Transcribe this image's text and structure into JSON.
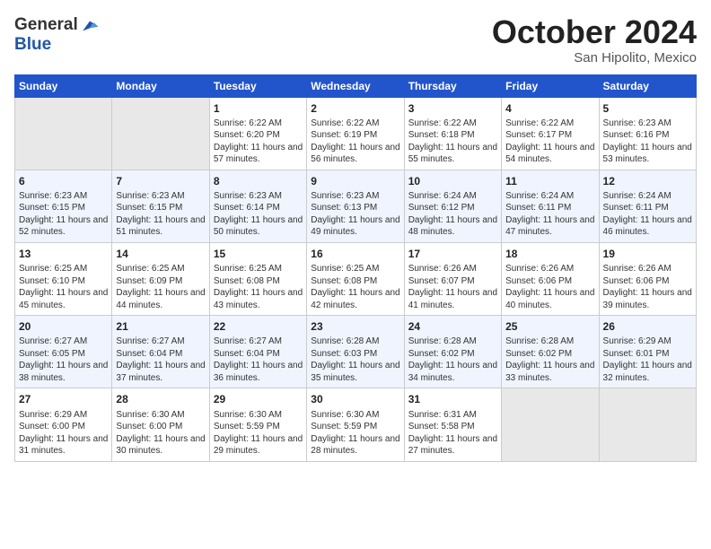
{
  "header": {
    "logo_line1": "General",
    "logo_line2": "Blue",
    "month": "October 2024",
    "location": "San Hipolito, Mexico"
  },
  "days_of_week": [
    "Sunday",
    "Monday",
    "Tuesday",
    "Wednesday",
    "Thursday",
    "Friday",
    "Saturday"
  ],
  "weeks": [
    [
      {
        "day": "",
        "sunrise": "",
        "sunset": "",
        "daylight": ""
      },
      {
        "day": "",
        "sunrise": "",
        "sunset": "",
        "daylight": ""
      },
      {
        "day": "1",
        "sunrise": "Sunrise: 6:22 AM",
        "sunset": "Sunset: 6:20 PM",
        "daylight": "Daylight: 11 hours and 57 minutes."
      },
      {
        "day": "2",
        "sunrise": "Sunrise: 6:22 AM",
        "sunset": "Sunset: 6:19 PM",
        "daylight": "Daylight: 11 hours and 56 minutes."
      },
      {
        "day": "3",
        "sunrise": "Sunrise: 6:22 AM",
        "sunset": "Sunset: 6:18 PM",
        "daylight": "Daylight: 11 hours and 55 minutes."
      },
      {
        "day": "4",
        "sunrise": "Sunrise: 6:22 AM",
        "sunset": "Sunset: 6:17 PM",
        "daylight": "Daylight: 11 hours and 54 minutes."
      },
      {
        "day": "5",
        "sunrise": "Sunrise: 6:23 AM",
        "sunset": "Sunset: 6:16 PM",
        "daylight": "Daylight: 11 hours and 53 minutes."
      }
    ],
    [
      {
        "day": "6",
        "sunrise": "Sunrise: 6:23 AM",
        "sunset": "Sunset: 6:15 PM",
        "daylight": "Daylight: 11 hours and 52 minutes."
      },
      {
        "day": "7",
        "sunrise": "Sunrise: 6:23 AM",
        "sunset": "Sunset: 6:15 PM",
        "daylight": "Daylight: 11 hours and 51 minutes."
      },
      {
        "day": "8",
        "sunrise": "Sunrise: 6:23 AM",
        "sunset": "Sunset: 6:14 PM",
        "daylight": "Daylight: 11 hours and 50 minutes."
      },
      {
        "day": "9",
        "sunrise": "Sunrise: 6:23 AM",
        "sunset": "Sunset: 6:13 PM",
        "daylight": "Daylight: 11 hours and 49 minutes."
      },
      {
        "day": "10",
        "sunrise": "Sunrise: 6:24 AM",
        "sunset": "Sunset: 6:12 PM",
        "daylight": "Daylight: 11 hours and 48 minutes."
      },
      {
        "day": "11",
        "sunrise": "Sunrise: 6:24 AM",
        "sunset": "Sunset: 6:11 PM",
        "daylight": "Daylight: 11 hours and 47 minutes."
      },
      {
        "day": "12",
        "sunrise": "Sunrise: 6:24 AM",
        "sunset": "Sunset: 6:11 PM",
        "daylight": "Daylight: 11 hours and 46 minutes."
      }
    ],
    [
      {
        "day": "13",
        "sunrise": "Sunrise: 6:25 AM",
        "sunset": "Sunset: 6:10 PM",
        "daylight": "Daylight: 11 hours and 45 minutes."
      },
      {
        "day": "14",
        "sunrise": "Sunrise: 6:25 AM",
        "sunset": "Sunset: 6:09 PM",
        "daylight": "Daylight: 11 hours and 44 minutes."
      },
      {
        "day": "15",
        "sunrise": "Sunrise: 6:25 AM",
        "sunset": "Sunset: 6:08 PM",
        "daylight": "Daylight: 11 hours and 43 minutes."
      },
      {
        "day": "16",
        "sunrise": "Sunrise: 6:25 AM",
        "sunset": "Sunset: 6:08 PM",
        "daylight": "Daylight: 11 hours and 42 minutes."
      },
      {
        "day": "17",
        "sunrise": "Sunrise: 6:26 AM",
        "sunset": "Sunset: 6:07 PM",
        "daylight": "Daylight: 11 hours and 41 minutes."
      },
      {
        "day": "18",
        "sunrise": "Sunrise: 6:26 AM",
        "sunset": "Sunset: 6:06 PM",
        "daylight": "Daylight: 11 hours and 40 minutes."
      },
      {
        "day": "19",
        "sunrise": "Sunrise: 6:26 AM",
        "sunset": "Sunset: 6:06 PM",
        "daylight": "Daylight: 11 hours and 39 minutes."
      }
    ],
    [
      {
        "day": "20",
        "sunrise": "Sunrise: 6:27 AM",
        "sunset": "Sunset: 6:05 PM",
        "daylight": "Daylight: 11 hours and 38 minutes."
      },
      {
        "day": "21",
        "sunrise": "Sunrise: 6:27 AM",
        "sunset": "Sunset: 6:04 PM",
        "daylight": "Daylight: 11 hours and 37 minutes."
      },
      {
        "day": "22",
        "sunrise": "Sunrise: 6:27 AM",
        "sunset": "Sunset: 6:04 PM",
        "daylight": "Daylight: 11 hours and 36 minutes."
      },
      {
        "day": "23",
        "sunrise": "Sunrise: 6:28 AM",
        "sunset": "Sunset: 6:03 PM",
        "daylight": "Daylight: 11 hours and 35 minutes."
      },
      {
        "day": "24",
        "sunrise": "Sunrise: 6:28 AM",
        "sunset": "Sunset: 6:02 PM",
        "daylight": "Daylight: 11 hours and 34 minutes."
      },
      {
        "day": "25",
        "sunrise": "Sunrise: 6:28 AM",
        "sunset": "Sunset: 6:02 PM",
        "daylight": "Daylight: 11 hours and 33 minutes."
      },
      {
        "day": "26",
        "sunrise": "Sunrise: 6:29 AM",
        "sunset": "Sunset: 6:01 PM",
        "daylight": "Daylight: 11 hours and 32 minutes."
      }
    ],
    [
      {
        "day": "27",
        "sunrise": "Sunrise: 6:29 AM",
        "sunset": "Sunset: 6:00 PM",
        "daylight": "Daylight: 11 hours and 31 minutes."
      },
      {
        "day": "28",
        "sunrise": "Sunrise: 6:30 AM",
        "sunset": "Sunset: 6:00 PM",
        "daylight": "Daylight: 11 hours and 30 minutes."
      },
      {
        "day": "29",
        "sunrise": "Sunrise: 6:30 AM",
        "sunset": "Sunset: 5:59 PM",
        "daylight": "Daylight: 11 hours and 29 minutes."
      },
      {
        "day": "30",
        "sunrise": "Sunrise: 6:30 AM",
        "sunset": "Sunset: 5:59 PM",
        "daylight": "Daylight: 11 hours and 28 minutes."
      },
      {
        "day": "31",
        "sunrise": "Sunrise: 6:31 AM",
        "sunset": "Sunset: 5:58 PM",
        "daylight": "Daylight: 11 hours and 27 minutes."
      },
      {
        "day": "",
        "sunrise": "",
        "sunset": "",
        "daylight": ""
      },
      {
        "day": "",
        "sunrise": "",
        "sunset": "",
        "daylight": ""
      }
    ]
  ]
}
